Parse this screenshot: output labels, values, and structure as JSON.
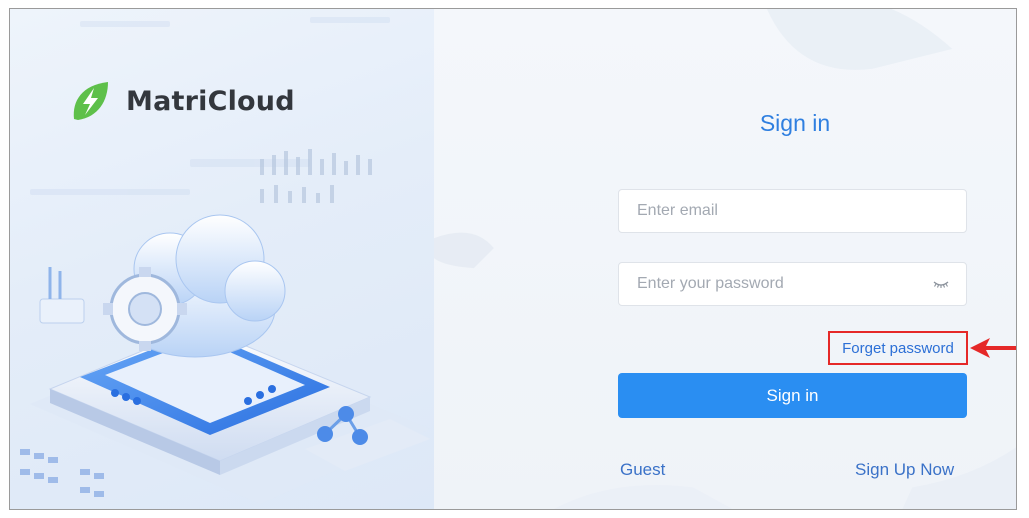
{
  "brand": {
    "name": "MatriCloud",
    "logo_icon": "leaf-lightning-logo-icon",
    "logo_color": "#5ec04a"
  },
  "login": {
    "title": "Sign in",
    "email_placeholder": "Enter email",
    "password_placeholder": "Enter your password",
    "password_toggle_icon": "eye-closed-icon",
    "forget_password_label": "Forget password",
    "sign_in_label": "Sign in",
    "guest_label": "Guest",
    "sign_up_label": "Sign Up Now"
  },
  "annotation": {
    "highlight_color": "#e52828",
    "arrow_icon": "red-arrow-left-icon"
  },
  "colors": {
    "primary": "#2a8ef2",
    "link": "#3b72c8",
    "title": "#2f7fe0"
  }
}
